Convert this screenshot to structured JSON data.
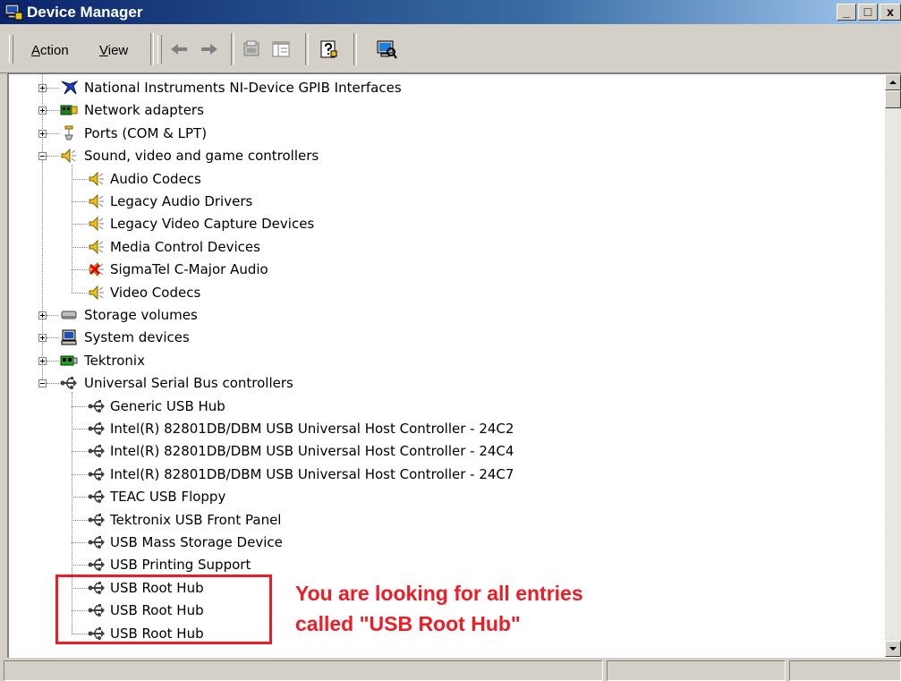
{
  "window": {
    "title": "Device Manager",
    "buttons": [
      "_",
      "□",
      "x"
    ]
  },
  "toolbar": {
    "menu": [
      {
        "accel": "A",
        "rest": "ction"
      },
      {
        "accel": "V",
        "rest": "iew"
      }
    ],
    "buttons": [
      "back",
      "forward",
      "properties",
      "show-hide-console-tree",
      "help",
      "scan-hardware"
    ]
  },
  "tree": {
    "items": [
      {
        "label": "National Instruments NI-Device GPIB Interfaces",
        "level": 0,
        "expander": "plus",
        "icon": "gpib-icon"
      },
      {
        "label": "Network adapters",
        "level": 0,
        "expander": "plus",
        "icon": "network-adapter-icon"
      },
      {
        "label": "Ports (COM & LPT)",
        "level": 0,
        "expander": "plus",
        "icon": "port-icon"
      },
      {
        "label": "Sound, video and game controllers",
        "level": 0,
        "expander": "minus",
        "icon": "speaker-icon"
      },
      {
        "label": "Audio Codecs",
        "level": 1,
        "icon": "speaker-icon"
      },
      {
        "label": "Legacy Audio Drivers",
        "level": 1,
        "icon": "speaker-icon"
      },
      {
        "label": "Legacy Video Capture Devices",
        "level": 1,
        "icon": "speaker-icon"
      },
      {
        "label": "Media Control Devices",
        "level": 1,
        "icon": "speaker-icon"
      },
      {
        "label": "SigmaTel C-Major Audio",
        "level": 1,
        "icon": "speaker-disabled-icon"
      },
      {
        "label": "Video Codecs",
        "level": 1,
        "icon": "speaker-icon"
      },
      {
        "label": "Storage volumes",
        "level": 0,
        "expander": "plus",
        "icon": "storage-volume-icon"
      },
      {
        "label": "System devices",
        "level": 0,
        "expander": "plus",
        "icon": "computer-icon"
      },
      {
        "label": "Tektronix",
        "level": 0,
        "expander": "plus",
        "icon": "board-icon"
      },
      {
        "label": "Universal Serial Bus controllers",
        "level": 0,
        "expander": "minus",
        "icon": "usb-icon"
      },
      {
        "label": "Generic USB Hub",
        "level": 1,
        "icon": "usb-icon"
      },
      {
        "label": "Intel(R) 82801DB/DBM USB Universal Host Controller - 24C2",
        "level": 1,
        "icon": "usb-icon"
      },
      {
        "label": "Intel(R) 82801DB/DBM USB Universal Host Controller - 24C4",
        "level": 1,
        "icon": "usb-icon"
      },
      {
        "label": "Intel(R) 82801DB/DBM USB Universal Host Controller - 24C7",
        "level": 1,
        "icon": "usb-icon"
      },
      {
        "label": "TEAC USB Floppy",
        "level": 1,
        "icon": "usb-icon"
      },
      {
        "label": "Tektronix USB Front Panel",
        "level": 1,
        "icon": "usb-icon"
      },
      {
        "label": "USB Mass Storage Device",
        "level": 1,
        "icon": "usb-icon"
      },
      {
        "label": "USB Printing Support",
        "level": 1,
        "icon": "usb-icon"
      },
      {
        "label": "USB Root Hub",
        "level": 1,
        "icon": "usb-icon"
      },
      {
        "label": "USB Root Hub",
        "level": 1,
        "icon": "usb-icon"
      },
      {
        "label": "USB Root Hub",
        "level": 1,
        "icon": "usb-icon"
      }
    ]
  },
  "annotation": {
    "line1": "You are looking for all entries",
    "line2": "called \"USB Root Hub\"",
    "color": "#ee1c25"
  },
  "colors": {
    "titlebar_start": "#0a246a",
    "titlebar_end": "#a6caf0",
    "chrome": "#d4d0c8"
  }
}
